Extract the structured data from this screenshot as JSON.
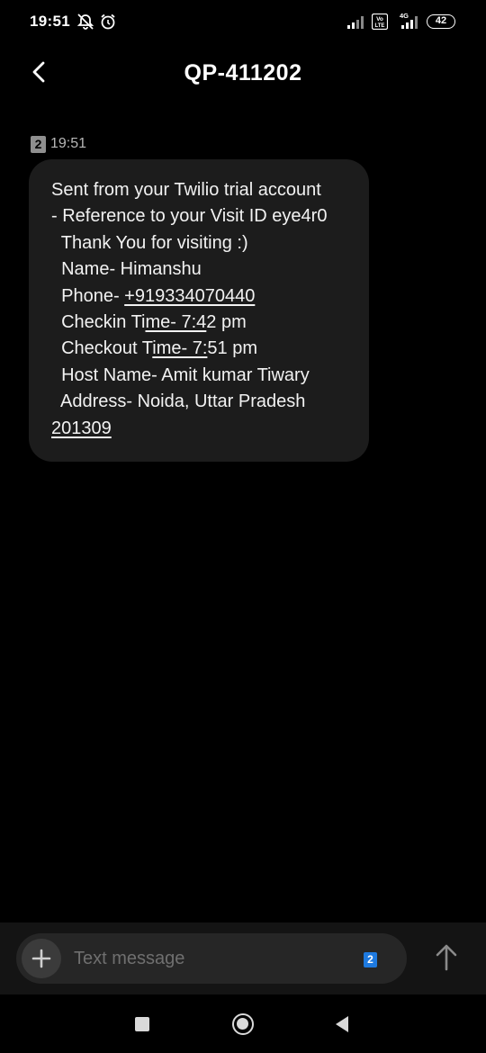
{
  "status_bar": {
    "time": "19:51",
    "icons": [
      "alarm-off-icon",
      "alarm-clock-icon",
      "signal-icon",
      "volte-icon",
      "signal-4g-icon",
      "battery-icon"
    ],
    "volte_label": "Vo\nLTE",
    "network_label": "4G",
    "battery_level": "42"
  },
  "header": {
    "title": "QP-411202"
  },
  "message": {
    "sim": "2",
    "time": "19:51",
    "lines": {
      "l1": "Sent from your Twilio trial account",
      "l2": "- Reference to your Visit ID eye4r0",
      "l3": "  Thank You for visiting :)",
      "l4": "  Name- Himanshu",
      "l5_prefix": "  Phone- ",
      "l5_phone": "+919334070440",
      "l6_a": "  Checkin Ti",
      "l6_b": "me- 7:4",
      "l6_c": "2 pm",
      "l7_a": "  Checkout T",
      "l7_b": "ime- 7:",
      "l7_c": "51 pm",
      "l8": "  Host Name- Amit kumar Tiwary",
      "l9": "  Address- Noida, Uttar Pradesh",
      "l10": "201309"
    }
  },
  "composer": {
    "placeholder": "Text message",
    "sim_selector": "2"
  },
  "colors": {
    "background": "#000000",
    "bubble": "#1c1c1c",
    "accent": "#1e7ae0"
  }
}
